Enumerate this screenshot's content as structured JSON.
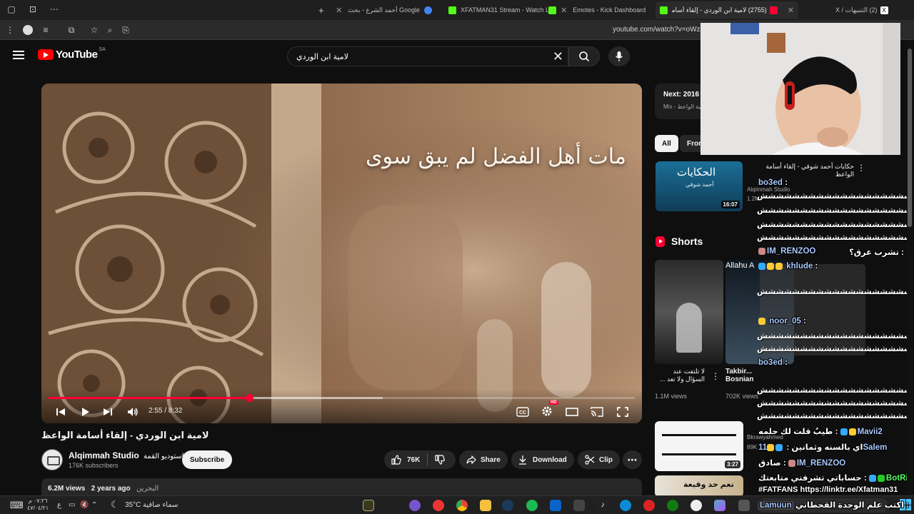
{
  "browser": {
    "tabs": [
      {
        "title": "(2) التنبيهات / X",
        "color": "#ffffff"
      },
      {
        "title": "(2755) لامية ابن الوردي - إلقاء أسامة الواعظ",
        "color": "#ff0033",
        "active": true
      },
      {
        "title": "Emotes - Kick Dashboard",
        "color": "#53fc18"
      },
      {
        "title": "XFATMAN31 Stream - Watch Li",
        "color": "#53fc18"
      },
      {
        "title": "أحمد الشرع - بحث Google",
        "color": "#4285f4"
      }
    ],
    "url": "youtube.com/watch?v=oWzo"
  },
  "youtube": {
    "logo_text": "YouTube",
    "region": "SA",
    "search_query": "لامية ابن الوردي"
  },
  "player": {
    "caption": "مات أهل الفضل لم يبق سوى",
    "time": "2:55 / 8:32",
    "progress_fraction": 0.342,
    "buffered_fraction": 0.57,
    "hd_badge": "HD"
  },
  "video": {
    "title": "لامية ابن الوردي - إلقاء أسامة الواعظ",
    "channel_name": "Alqimmah Studio",
    "channel_name_ar": "استوديو القمة",
    "subscribers": "176K subscribers",
    "subscribe_label": "Subscribe",
    "likes": "76K",
    "share_label": "Share",
    "download_label": "Download",
    "clip_label": "Clip",
    "views": "6.2M views",
    "age": "2 years ago",
    "location": "البحرين"
  },
  "sidebar": {
    "next_label": "Next: 2016",
    "next_sub": "Mix - لامية الواعظ",
    "chips": [
      "All",
      "Fron"
    ],
    "rec1": {
      "thumb_title": "الحكايات",
      "thumb_sub": "أحمد شوقي",
      "duration": "16:07",
      "title": "حكايات أحمد شوقي - إلقاء أسامة الواعظ",
      "channel": "Alqimmah Studio",
      "views": "1.2M"
    },
    "shorts_title": "Shorts",
    "shorts": [
      {
        "title": "لا تلتفت عند السؤال ولا تعد ...",
        "views": "1.1M views"
      },
      {
        "title": "Takbir... Bosnian",
        "views": "702K views",
        "overlay": "Allahu A"
      }
    ],
    "rec2": {
      "duration": "3:27",
      "channel": "Bkrawyahmed",
      "views": "89K"
    },
    "rec3": {
      "thumb_text": "نعم حد وقيعة"
    }
  },
  "chat": [
    {
      "user": "bo3ed",
      "text": ""
    },
    {
      "user": "",
      "text": "ششششششششششششششششششش"
    },
    {
      "user": "",
      "text": "ششششششششششششششششششش"
    },
    {
      "user": "",
      "text": "ششششششششششششششششششش"
    },
    {
      "user": "",
      "text": "تشرب عرق؟ :",
      "trailing": "IM_RENZOO"
    },
    {
      "user": "khlude",
      "text": ""
    },
    {
      "user": "noor_05",
      "text": ""
    },
    {
      "user": "bo3ed",
      "text": ""
    },
    {
      "user": "",
      "text": "ششششششششششششششششششش"
    },
    {
      "user": "",
      "text": "ششششششششششششششششششش"
    },
    {
      "user": "Mavii2",
      "text": "طيبٌ قلت لك حلمه :"
    },
    {
      "user": "11Salem",
      "text": "اي بالسنه وثمانين :"
    },
    {
      "user": "IM_RENZOO",
      "text": "صادق :"
    },
    {
      "user": "BotRix",
      "text": "حساباتي تشرفني متابعتك :"
    },
    {
      "user": "",
      "text": "#FATFANS https://linktr.ee/Xfatman31"
    },
    {
      "user": "Lamuun",
      "text": "اكتب علم الوحدة القحطاني :"
    }
  ],
  "taskbar": {
    "weather_temp": "35°C",
    "weather_text": "سماء صافية",
    "time": "٠٧:٢٦ م",
    "date": "٤٧/٠٤/٢١"
  }
}
